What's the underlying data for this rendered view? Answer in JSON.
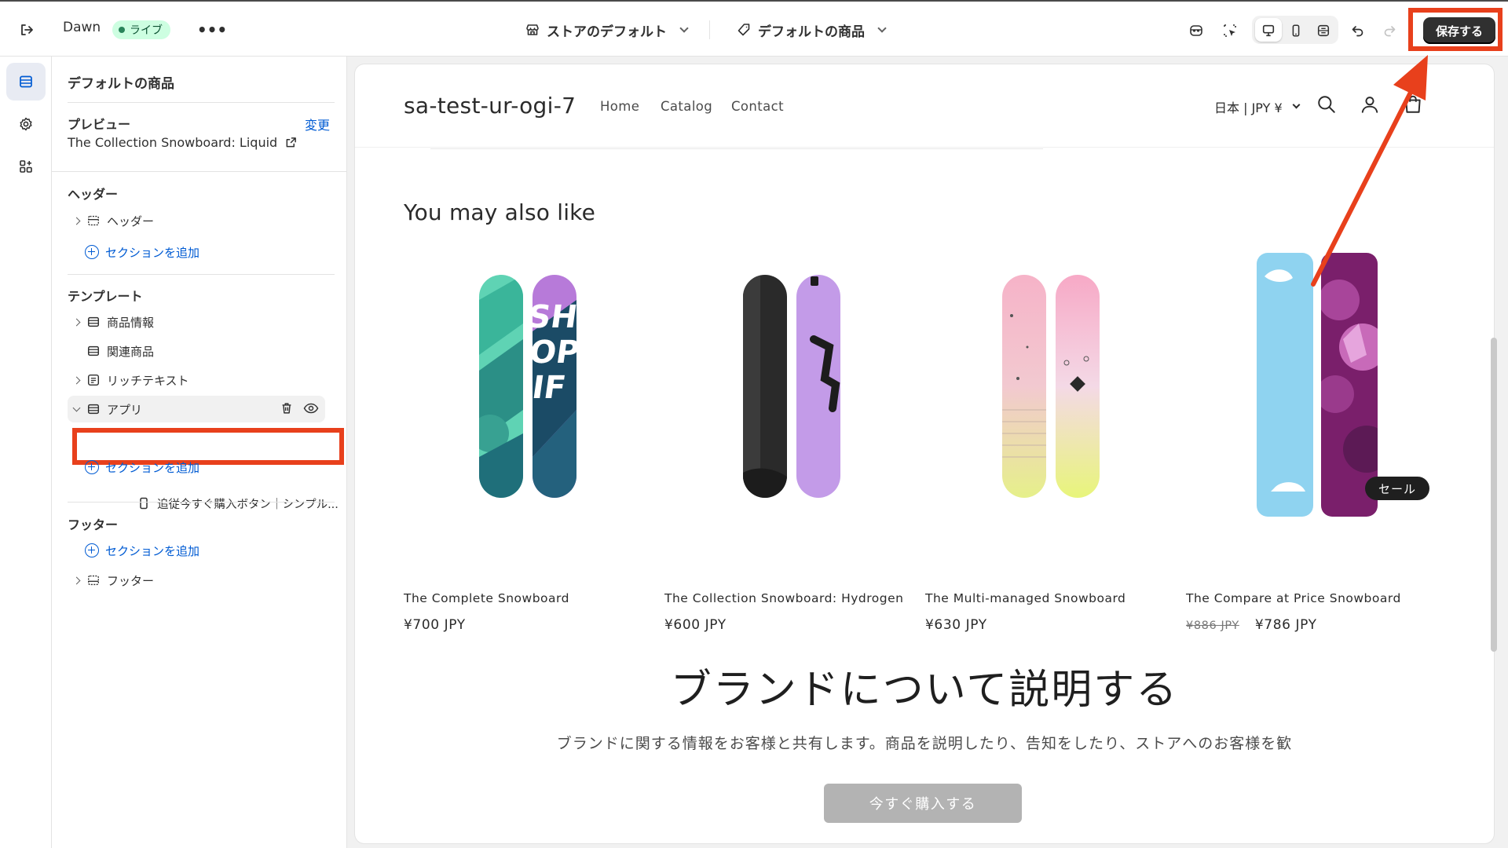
{
  "topbar": {
    "theme_name": "Dawn",
    "live_badge": "ライブ",
    "more": "•••",
    "store_selector": "ストアのデフォルト",
    "product_selector": "デフォルトの商品",
    "save_label": "保存する"
  },
  "sidebar": {
    "title": "デフォルトの商品",
    "preview_heading": "プレビュー",
    "preview_change": "変更",
    "preview_product": "The Collection Snowboard: Liquid",
    "header_heading": "ヘッダー",
    "header_item": "ヘッダー",
    "add_section": "セクションを追加",
    "template_heading": "テンプレート",
    "template_items": [
      "商品情報",
      "関連商品",
      "リッチテキスト",
      "アプリ"
    ],
    "app_block": "追従今すぐ購入ボタン｜シンプル...",
    "footer_heading": "フッター",
    "footer_item": "フッター"
  },
  "preview": {
    "store_name": "sa-test-ur-ogi-7",
    "nav": [
      "Home",
      "Catalog",
      "Contact"
    ],
    "country": "日本 | JPY ¥",
    "section_title": "You may also like",
    "products": [
      {
        "name": "The Complete Snowboard",
        "price": "¥700 JPY"
      },
      {
        "name": "The Collection Snowboard: Hydrogen",
        "price": "¥600 JPY"
      },
      {
        "name": "The Multi-managed Snowboard",
        "price": "¥630 JPY"
      },
      {
        "name": "The Compare at Price Snowboard",
        "old_price": "¥886 JPY",
        "price": "¥786 JPY"
      }
    ],
    "sale_badge": "セール",
    "brand_title": "ブランドについて説明する",
    "brand_text": "ブランドに関する情報をお客様と共有します。商品を説明したり、告知をしたり、ストアへのお客様を歓",
    "buy_button": "今すぐ購入する"
  },
  "colors": {
    "accent_link": "#005bd3",
    "highlight": "#e8401c",
    "save_button": "#303030",
    "live_badge": "#cdfee1"
  }
}
